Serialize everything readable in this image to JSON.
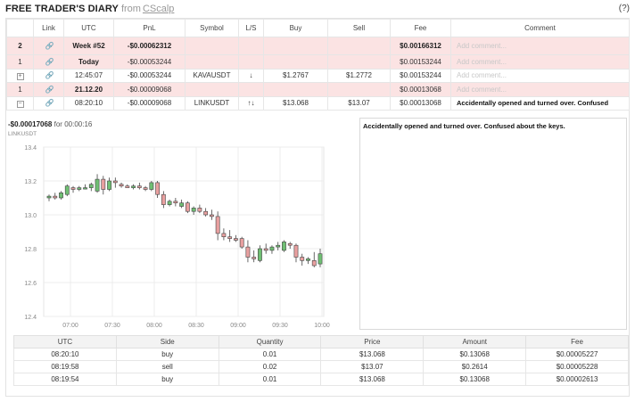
{
  "header": {
    "title": "FREE TRADER'S DIARY",
    "from": "from",
    "brand": "CScalp",
    "help": "(?)"
  },
  "trades": {
    "columns": [
      "",
      "Link",
      "UTC",
      "PnL",
      "Symbol",
      "L/S",
      "Buy",
      "Sell",
      "Fee",
      "Comment"
    ],
    "week_row": {
      "count": "2",
      "label": "Week #52",
      "pnl": "-$0.00062312",
      "fee": "$0.00166312",
      "comment": "Add comment..."
    },
    "today_row": {
      "count": "1",
      "label": "Today",
      "pnl": "-$0.00053244",
      "fee": "$0.00153244",
      "comment": "Add comment..."
    },
    "trade1": {
      "toggle": "+",
      "utc": "12:45:07",
      "pnl": "-$0.00053244",
      "symbol": "KAVAUSDT",
      "ls": "↓",
      "buy": "$1.2767",
      "sell": "$1.2772",
      "fee": "$0.00153244",
      "comment": "Add comment..."
    },
    "day_row": {
      "count": "1",
      "label": "21.12.20",
      "pnl": "-$0.00009068",
      "fee": "$0.00013068",
      "comment": "Add comment..."
    },
    "trade2": {
      "toggle": "−",
      "utc": "08:20:10",
      "pnl": "-$0.00009068",
      "symbol": "LINKUSDT",
      "ls": "↑↓",
      "buy": "$13.068",
      "sell": "$13.07",
      "fee": "$0.00013068",
      "comment": "Accidentally opened and turned over. Confused"
    }
  },
  "chart_head": {
    "pnl": "-$0.00017068",
    "for": "for",
    "duration": "00:00:16",
    "symbol": "LINKUSDT"
  },
  "chart_data": {
    "type": "candlestick",
    "ylim": [
      12.4,
      13.4
    ],
    "yticks": [
      "13.4",
      "13.2",
      "13.0",
      "12.8",
      "12.6",
      "12.4"
    ],
    "xticks": [
      "07:00",
      "07:30",
      "08:00",
      "08:30",
      "09:00",
      "09:30",
      "10:00"
    ],
    "candles": [
      [
        13.1,
        13.12,
        13.08,
        13.11
      ],
      [
        13.11,
        13.13,
        13.09,
        13.1
      ],
      [
        13.1,
        13.14,
        13.09,
        13.13
      ],
      [
        13.12,
        13.18,
        13.11,
        13.17
      ],
      [
        13.16,
        13.17,
        13.13,
        13.15
      ],
      [
        13.15,
        13.17,
        13.14,
        13.16
      ],
      [
        13.16,
        13.18,
        13.15,
        13.16
      ],
      [
        13.16,
        13.19,
        13.14,
        13.18
      ],
      [
        13.14,
        13.24,
        13.13,
        13.21
      ],
      [
        13.21,
        13.23,
        13.12,
        13.15
      ],
      [
        13.15,
        13.22,
        13.14,
        13.2
      ],
      [
        13.2,
        13.22,
        13.16,
        13.19
      ],
      [
        13.18,
        13.19,
        13.16,
        13.17
      ],
      [
        13.17,
        13.18,
        13.16,
        13.16
      ],
      [
        13.16,
        13.18,
        13.15,
        13.17
      ],
      [
        13.17,
        13.19,
        13.15,
        13.16
      ],
      [
        13.16,
        13.17,
        13.14,
        13.15
      ],
      [
        13.15,
        13.2,
        13.14,
        13.19
      ],
      [
        13.19,
        13.2,
        13.1,
        13.12
      ],
      [
        13.12,
        13.14,
        13.04,
        13.06
      ],
      [
        13.06,
        13.09,
        13.05,
        13.08
      ],
      [
        13.08,
        13.1,
        13.05,
        13.07
      ],
      [
        13.05,
        13.09,
        13.04,
        13.07
      ],
      [
        13.07,
        13.08,
        13.01,
        13.02
      ],
      [
        13.02,
        13.05,
        13.0,
        13.04
      ],
      [
        13.04,
        13.06,
        13.01,
        13.02
      ],
      [
        13.02,
        13.04,
        12.99,
        13.0
      ],
      [
        13.0,
        13.03,
        12.97,
        12.99
      ],
      [
        12.99,
        13.02,
        12.85,
        12.89
      ],
      [
        12.89,
        12.92,
        12.85,
        12.87
      ],
      [
        12.87,
        12.91,
        12.84,
        12.86
      ],
      [
        12.86,
        12.88,
        12.84,
        12.85
      ],
      [
        12.86,
        12.87,
        12.8,
        12.81
      ],
      [
        12.81,
        12.85,
        12.72,
        12.75
      ],
      [
        12.75,
        12.79,
        12.72,
        12.74
      ],
      [
        12.73,
        12.82,
        12.72,
        12.8
      ],
      [
        12.8,
        12.83,
        12.77,
        12.79
      ],
      [
        12.79,
        12.82,
        12.77,
        12.81
      ],
      [
        12.81,
        12.84,
        12.79,
        12.82
      ],
      [
        12.79,
        12.85,
        12.78,
        12.84
      ],
      [
        12.83,
        12.84,
        12.8,
        12.82
      ],
      [
        12.82,
        12.83,
        12.72,
        12.75
      ],
      [
        12.75,
        12.77,
        12.7,
        12.73
      ],
      [
        12.73,
        12.75,
        12.71,
        12.74
      ],
      [
        12.73,
        12.78,
        12.69,
        12.7
      ],
      [
        12.71,
        12.8,
        12.69,
        12.77
      ]
    ]
  },
  "comment_box": {
    "text": "Accidentally opened and turned over. Confused about the keys."
  },
  "fills": {
    "columns": [
      "UTC",
      "Side",
      "Quantity",
      "Price",
      "Amount",
      "Fee"
    ],
    "rows": [
      [
        "08:20:10",
        "buy",
        "0.01",
        "$13.068",
        "$0.13068",
        "$0.00005227"
      ],
      [
        "08:19:58",
        "sell",
        "0.02",
        "$13.07",
        "$0.2614",
        "$0.00005228"
      ],
      [
        "08:19:54",
        "buy",
        "0.01",
        "$13.068",
        "$0.13068",
        "$0.00002613"
      ]
    ]
  },
  "colors": {
    "up": "#6fbf73",
    "down": "#e9a0a0",
    "candle_stroke": "#444444",
    "row_pink": "#fbe3e3"
  },
  "icons": {
    "link": "link-icon",
    "expand": "plus-box-icon",
    "collapse": "minus-box-icon"
  }
}
